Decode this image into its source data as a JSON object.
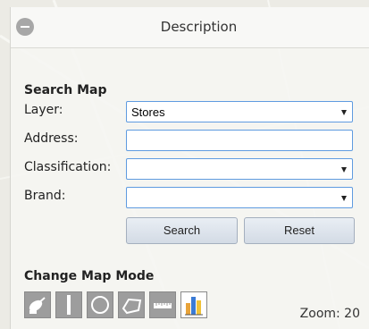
{
  "panel": {
    "title": "Description"
  },
  "search": {
    "heading": "Search Map",
    "layer": {
      "label": "Layer:",
      "value": "Stores"
    },
    "address": {
      "label": "Address:",
      "value": ""
    },
    "classification": {
      "label": "Classification:",
      "value": ""
    },
    "brand": {
      "label": "Brand:",
      "value": ""
    },
    "search_button": "Search",
    "reset_button": "Reset"
  },
  "mode": {
    "heading": "Change Map Mode",
    "tools": [
      "satellite-icon",
      "line-icon",
      "circle-icon",
      "polygon-icon",
      "ruler-icon",
      "chart-icon"
    ]
  },
  "zoom": {
    "text": "Zoom: 20"
  },
  "colors": {
    "field_border": "#5f9be0",
    "tool_bg": "#9d9d9d",
    "chart_bars": [
      "#e8a33a",
      "#3a7bd5",
      "#f0c238"
    ]
  }
}
